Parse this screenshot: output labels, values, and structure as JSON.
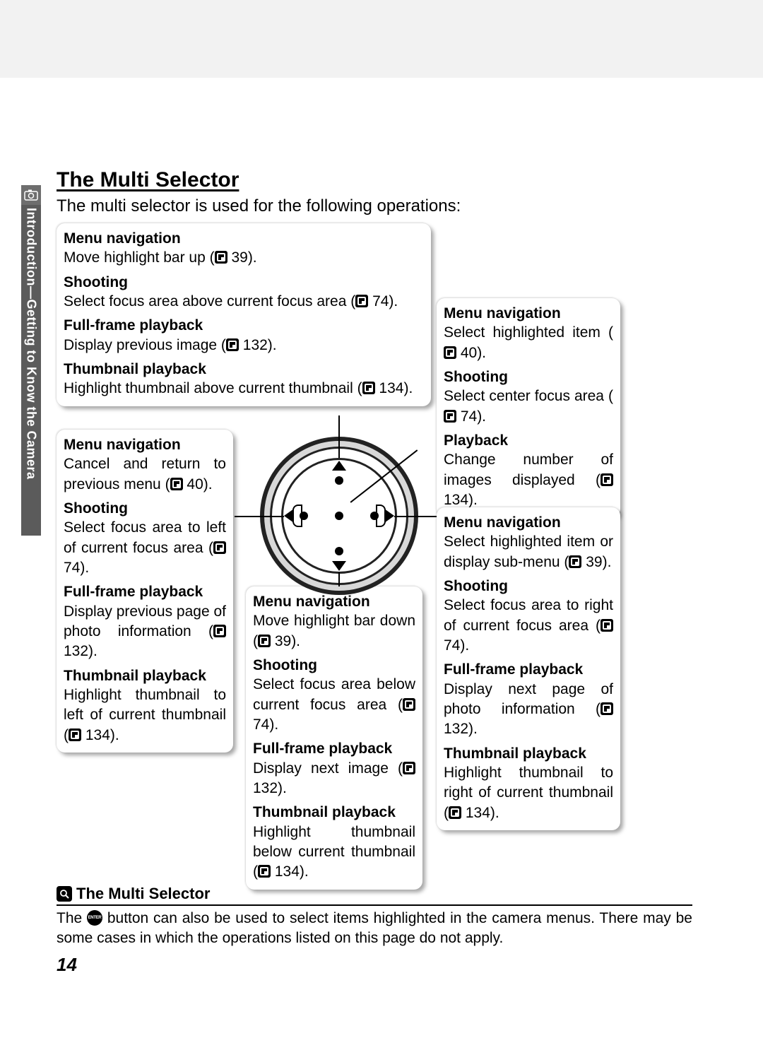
{
  "side_tab": {
    "label": "Introduction—Getting to Know the Camera"
  },
  "title": "The Multi Selector",
  "intro": "The multi selector is used for the following operations:",
  "page_number": "14",
  "note": {
    "title": "The Multi Selector",
    "body_before": "The ",
    "body_after": " button can also be used to select items highlighted in the camera menus.  There may be some cases in which the operations listed on this page do not apply."
  },
  "blocks": {
    "up": [
      {
        "title": "Menu navigation",
        "desc_before": "Move highlight bar up (",
        "desc_after": " 39)."
      },
      {
        "title": "Shooting",
        "desc_before": "Select focus area above current focus area (",
        "desc_after": " 74)."
      },
      {
        "title": "Full-frame playback",
        "desc_before": "Display previous image (",
        "desc_after": " 132)."
      },
      {
        "title": "Thumbnail playback",
        "desc_before": "Highlight thumbnail above current thumbnail (",
        "desc_after": " 134)."
      }
    ],
    "left": [
      {
        "title": "Menu navigation",
        "desc_before": "Cancel and return to previous menu (",
        "desc_after": " 40)."
      },
      {
        "title": "Shooting",
        "desc_before": "Select focus area to left of current focus area (",
        "desc_after": " 74)."
      },
      {
        "title": "Full-frame playback",
        "desc_before": "Display previous page of photo information (",
        "desc_after": " 132)."
      },
      {
        "title": "Thumbnail playback",
        "desc_before": "Highlight thumbnail to left of current thumbnail (",
        "desc_after": " 134)."
      }
    ],
    "down": [
      {
        "title": "Menu navigation",
        "desc_before": "Move highlight bar down (",
        "desc_after": " 39)."
      },
      {
        "title": "Shooting",
        "desc_before": "Select focus area below current focus area (",
        "desc_after": " 74)."
      },
      {
        "title": "Full-frame playback",
        "desc_before": "Display next image (",
        "desc_after": " 132)."
      },
      {
        "title": "Thumbnail playback",
        "desc_before": "Highlight thumbnail below current thumbnail (",
        "desc_after": " 134)."
      }
    ],
    "center": [
      {
        "title": "Menu navigation",
        "desc_before": "Select highlighted item (",
        "desc_after": " 40)."
      },
      {
        "title": "Shooting",
        "desc_before": "Select center focus area (",
        "desc_after": " 74)."
      },
      {
        "title": "Playback",
        "desc_before": "Change number of images displayed (",
        "desc_after": " 134)."
      }
    ],
    "right": [
      {
        "title": "Menu navigation",
        "desc_before": "Select highlighted item or display sub-menu (",
        "desc_after": " 39)."
      },
      {
        "title": "Shooting",
        "desc_before": "Select focus area to right of current focus area (",
        "desc_after": " 74)."
      },
      {
        "title": "Full-frame playback",
        "desc_before": "Display next page of photo information (",
        "desc_after": " 132)."
      },
      {
        "title": "Thumbnail playback",
        "desc_before": "Highlight thumbnail to right of current thumbnail (",
        "desc_after": " 134)."
      }
    ]
  }
}
